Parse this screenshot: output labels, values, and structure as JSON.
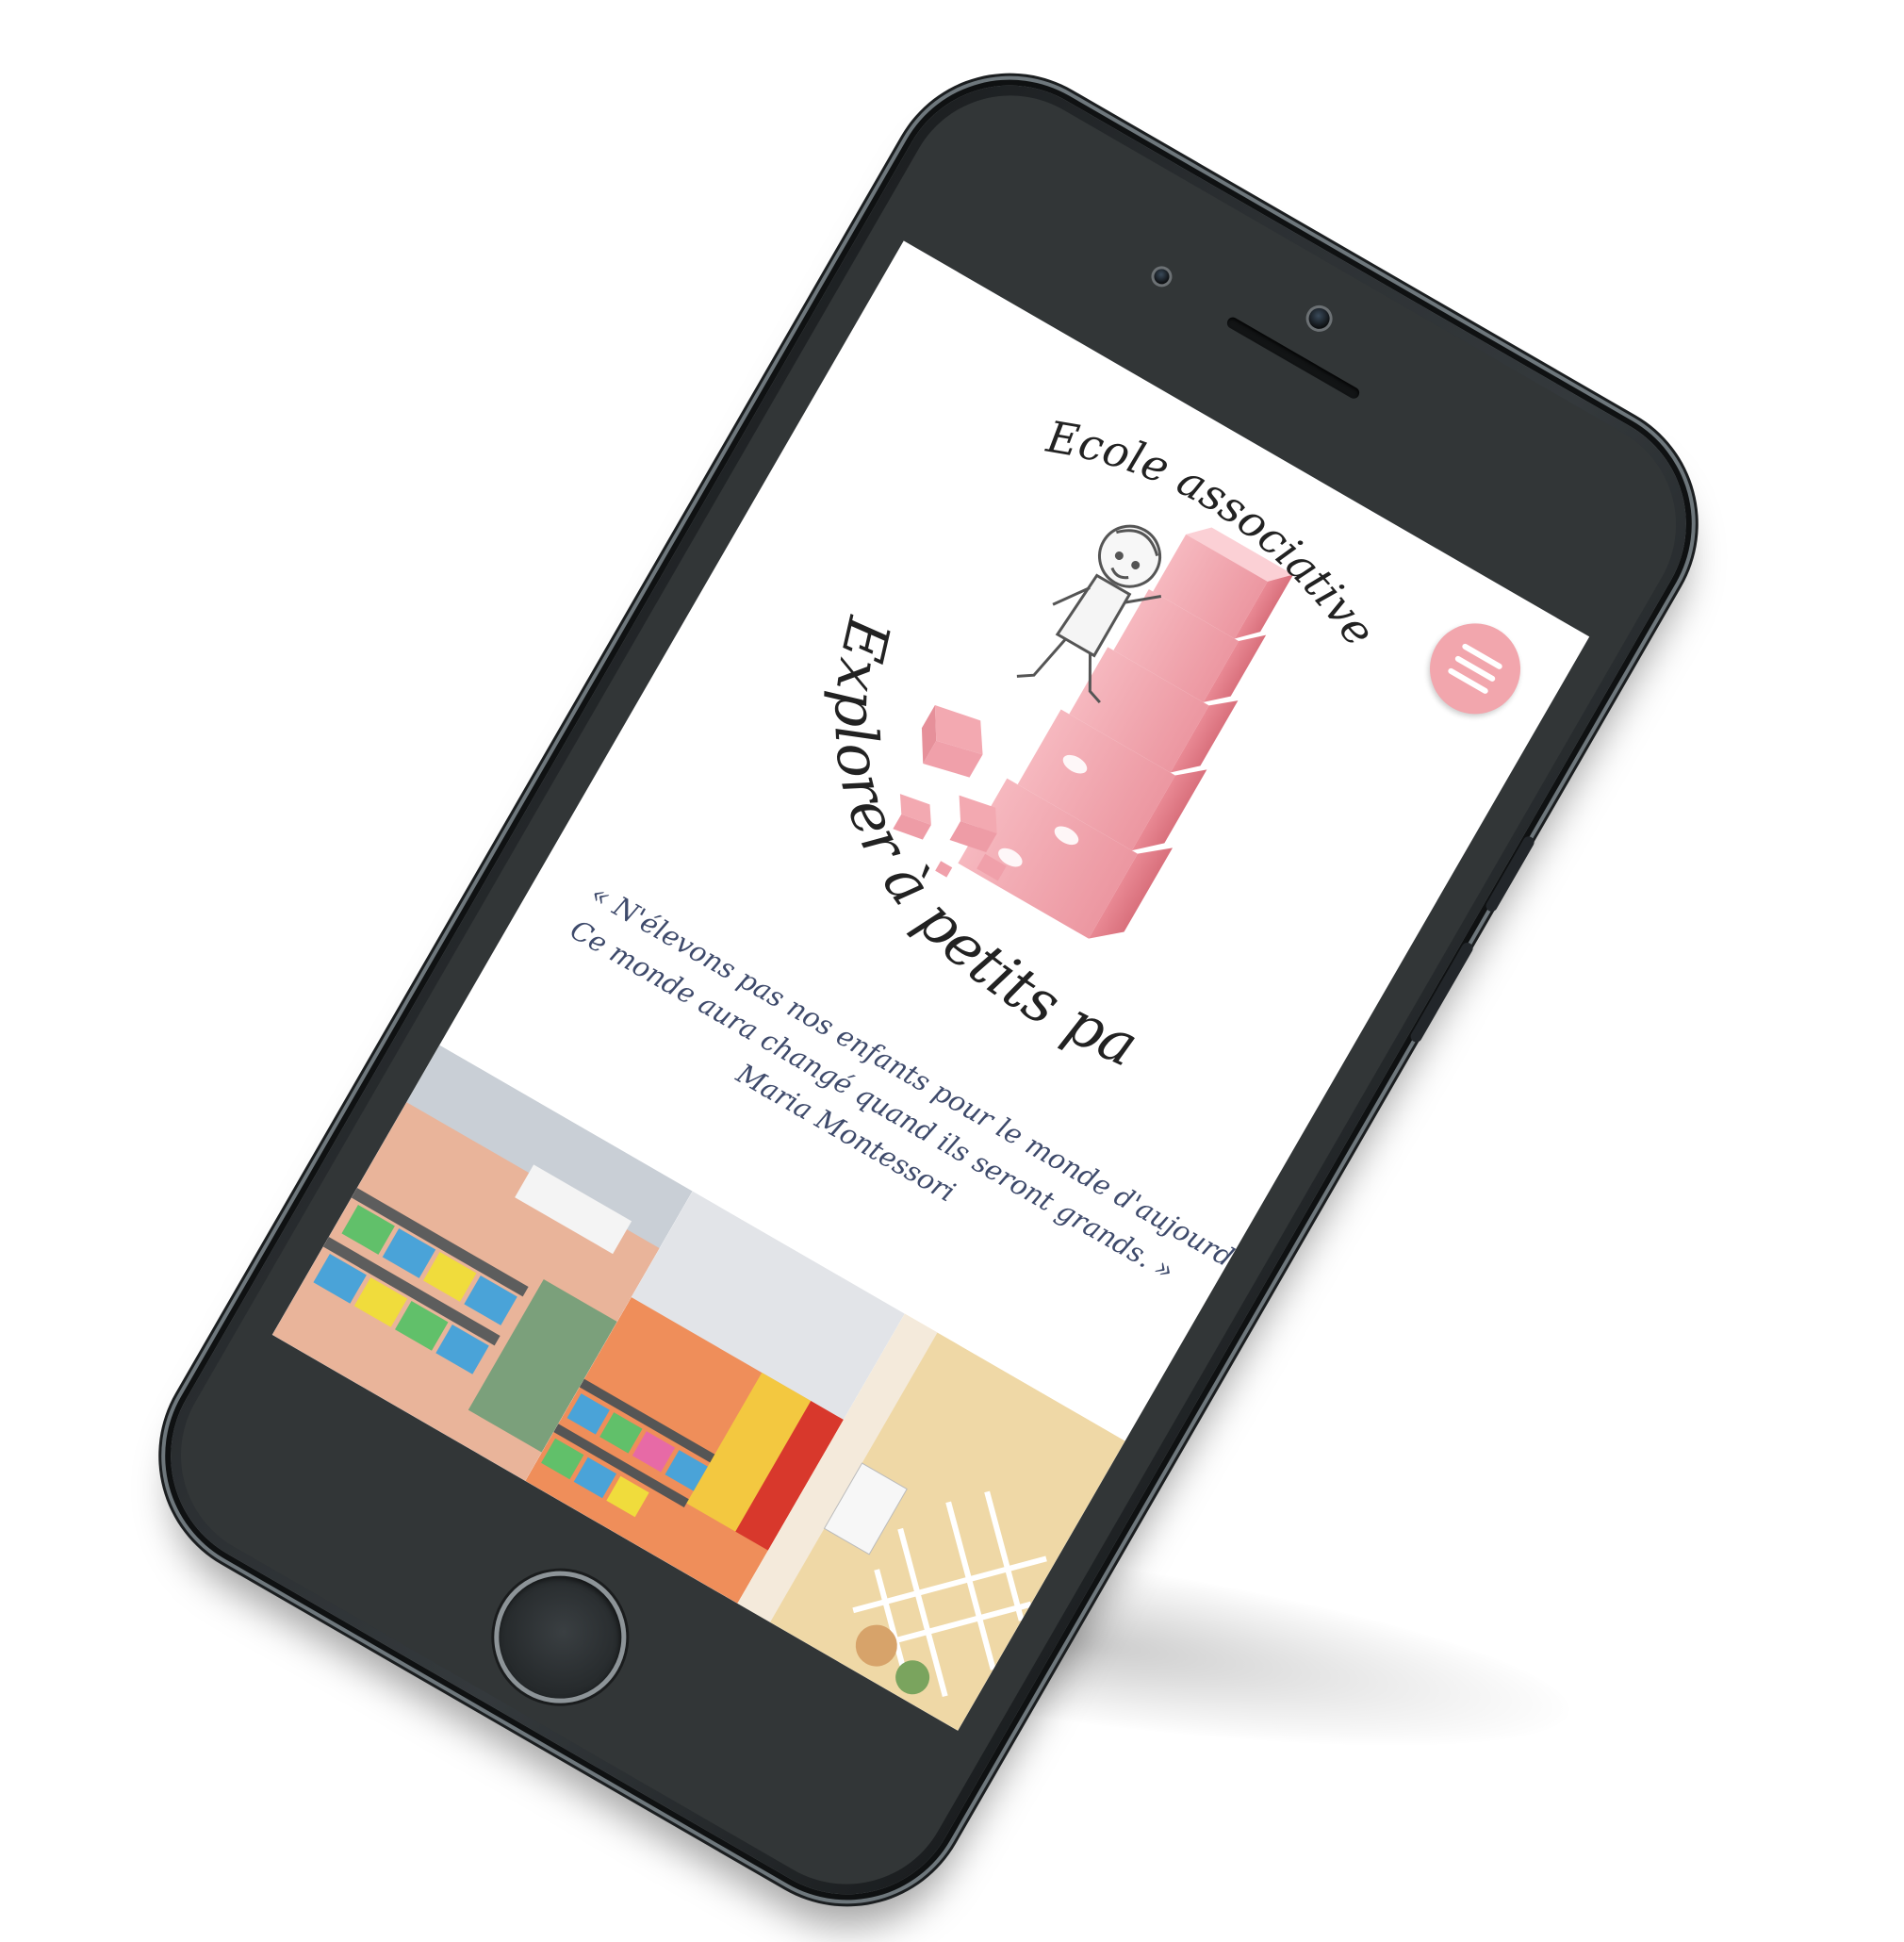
{
  "colors": {
    "accent_pink": "#f2a6ad",
    "quote_text": "#3e4a6b",
    "phone_body": "#2c3033"
  },
  "header": {
    "menu_icon": "hamburger-menu-icon"
  },
  "logo": {
    "line1": "Ecole associative",
    "line2": "Explorer à petits pas"
  },
  "quote": {
    "line1": "« N'élevons pas nos enfants pour le monde d'aujourd'hui.",
    "line2": "Ce monde aura changé quand ils seront grands. »",
    "author": "Maria Montessori"
  },
  "photos": {
    "count": 3
  }
}
